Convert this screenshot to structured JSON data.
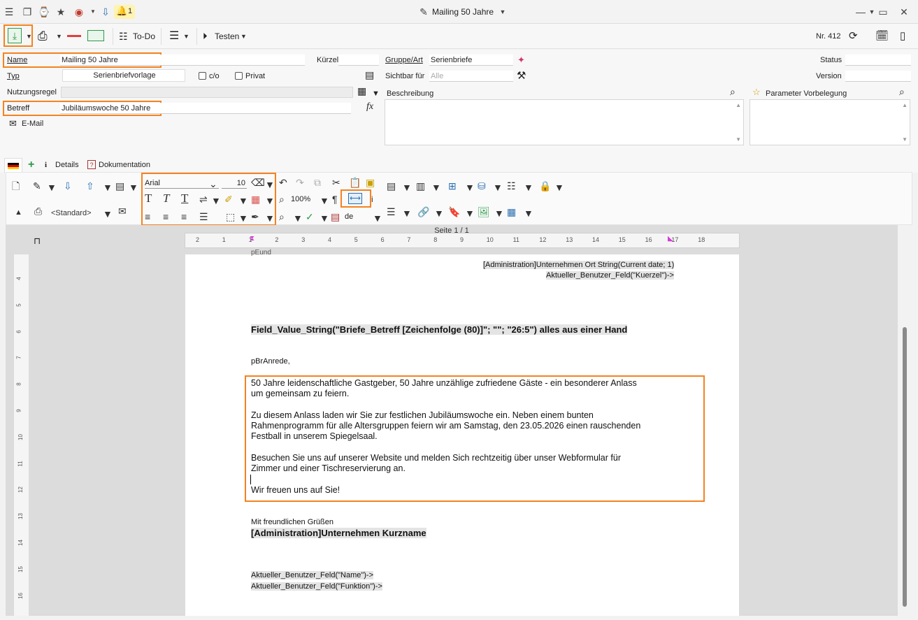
{
  "window": {
    "title": "Mailing 50 Jahre",
    "notification_count": "1"
  },
  "toolbar": {
    "todo_label": "To-Do",
    "test_label": "Testen",
    "record_number": "Nr. 412"
  },
  "form": {
    "name_label": "Name",
    "name_value": "Mailing 50 Jahre",
    "kuerzel_label": "Kürzel",
    "kuerzel_value": "",
    "gruppe_label": "Gruppe/Art",
    "gruppe_value": "Serienbriefe",
    "status_label": "Status",
    "status_value": "",
    "typ_label": "Typ",
    "typ_value": "Serienbriefvorlage",
    "co_label": "c/o",
    "privat_label": "Privat",
    "sichtbar_label": "Sichtbar für",
    "sichtbar_placeholder": "Alle",
    "version_label": "Version",
    "version_value": "",
    "nutzungsregel_label": "Nutzungsregel",
    "beschreibung_label": "Beschreibung",
    "parameter_label": "Parameter Vorbelegung",
    "betreff_label": "Betreff",
    "betreff_value": "Jubiläumswoche 50 Jahre",
    "email_label": "E-Mail"
  },
  "tabs": {
    "details": "Details",
    "dokumentation": "Dokumentation"
  },
  "ribbon": {
    "style_value": "<Standard>",
    "font_name": "Arial",
    "font_size": "10",
    "zoom": "100%",
    "language": "de"
  },
  "ruler": {
    "page_indicator": "Seite 1 / 1",
    "ticks": [
      "2",
      "1",
      "1",
      "2",
      "3",
      "4",
      "5",
      "6",
      "7",
      "8",
      "9",
      "10",
      "11",
      "12",
      "13",
      "14",
      "15",
      "16",
      "17",
      "18"
    ],
    "vticks": [
      "4",
      "5",
      "6",
      "7",
      "8",
      "9",
      "10",
      "11",
      "12",
      "13",
      "14",
      "15",
      "16"
    ]
  },
  "document": {
    "top_partial": "pEund",
    "header_line1": "[Administration]Unternehmen Ort String(Current date; 1)",
    "header_line2": "Aktueller_Benutzer_Feld(\"Kuerzel\")->",
    "subject": "Field_Value_String(\"Briefe_Betreff [Zeichenfolge (80)]\"; \"\"; \"26:5\") alles aus einer Hand",
    "salutation": "pBrAnrede,",
    "para1_line1": "50 Jahre leidenschaftliche Gastgeber, 50 Jahre unzählige zufriedene Gäste - ein besonderer Anlass",
    "para1_line2": "um gemeinsam zu feiern.",
    "para2_line1": "Zu diesem Anlass laden wir Sie zur festlichen Jubiläumswoche ein. Neben einem bunten",
    "para2_line2": "Rahmenprogramm für alle Altersgruppen feiern wir am Samstag, den 23.05.2026 einen rauschenden",
    "para2_line3": "Festball in unserem Spiegelsaal.",
    "para3_line1": "Besuchen Sie uns auf unserer Website und melden Sich rechtzeitig über unser Webformular für",
    "para3_line2": "Zimmer und einer Tischreservierung an.",
    "closing": "Wir freuen uns auf Sie!",
    "greeting": "Mit freundlichen Grüßen",
    "company": "[Administration]Unternehmen Kurzname",
    "sig_name": "Aktueller_Benutzer_Feld(\"Name\")->",
    "sig_function": "Aktueller_Benutzer_Feld(\"Funktion\")->"
  },
  "colors": {
    "highlight": "#f5821f",
    "field_bg": "#e4e4e4"
  }
}
